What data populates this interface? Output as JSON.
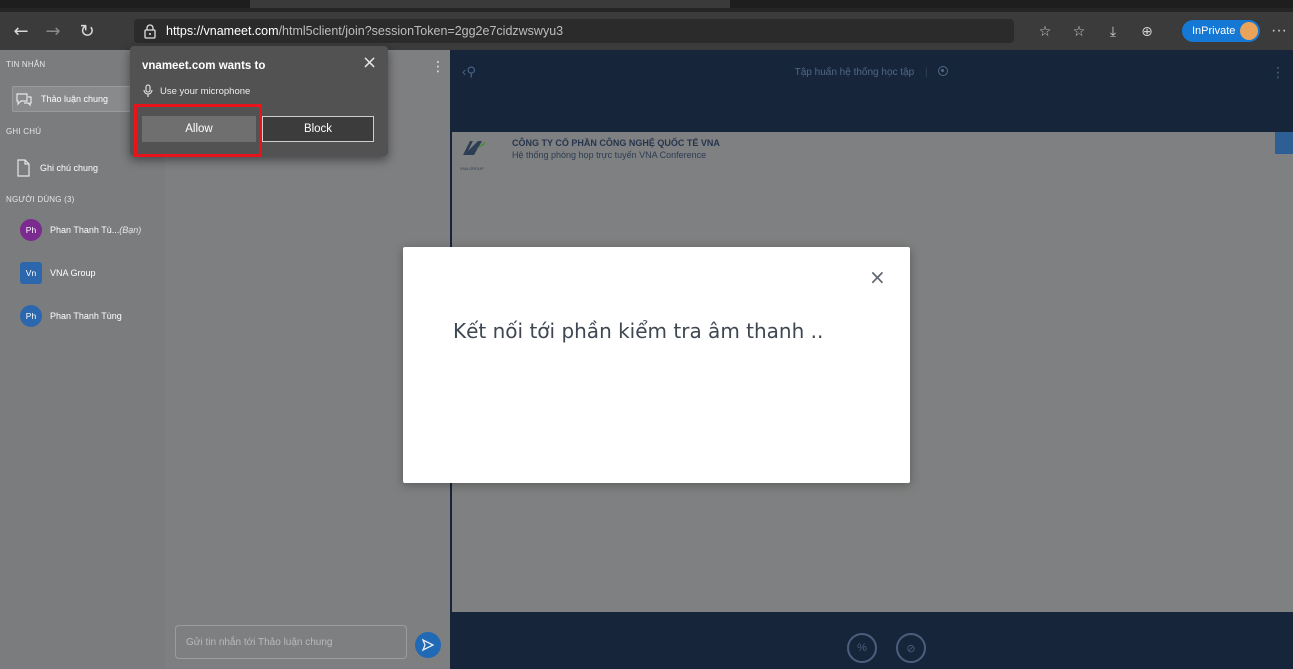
{
  "browser": {
    "url_host": "https://vnameet.com",
    "url_path": "/html5client/join?sessionToken=2gg2e7cidzwswyu3",
    "inprivate_label": "InPrivate"
  },
  "sidebar": {
    "messages_title": "TIN NHẮN",
    "public_chat_label": "Thảo luận chung",
    "notes_title": "GHI CHÚ",
    "shared_notes_label": "Ghi chú chung",
    "users_title": "NGƯỜI DÙNG (3)",
    "users": [
      {
        "initials": "Ph",
        "name": "Phan Thanh Tù...",
        "suffix": "(Bạn)",
        "color": "#7b2a8f"
      },
      {
        "initials": "Vn",
        "name": "VNA Group",
        "suffix": "",
        "color": "#2c67ad"
      },
      {
        "initials": "Ph",
        "name": "Phan Thanh Tùng",
        "suffix": "",
        "color": "#2c67ad"
      }
    ]
  },
  "chat": {
    "input_placeholder": "Gửi tin nhắn tới Thảo luận chung"
  },
  "main": {
    "session_title": "Tập huấn hệ thống học tập",
    "presentation_company": "CÔNG TY CỔ PHẦN CÔNG NGHỆ QUỐC TẾ VNA",
    "presentation_subtitle": "Hệ thống phòng họp trực tuyến VNA Conference",
    "logo_caption": "VNA GROUP"
  },
  "permission": {
    "title": "vnameet.com wants to",
    "request": "Use your microphone",
    "allow_label": "Allow",
    "block_label": "Block"
  },
  "modal": {
    "message": "Kết nối tới phần kiểm tra âm thanh  .."
  },
  "colors": {
    "accent": "#2069b5",
    "highlight": "#e8141b"
  }
}
